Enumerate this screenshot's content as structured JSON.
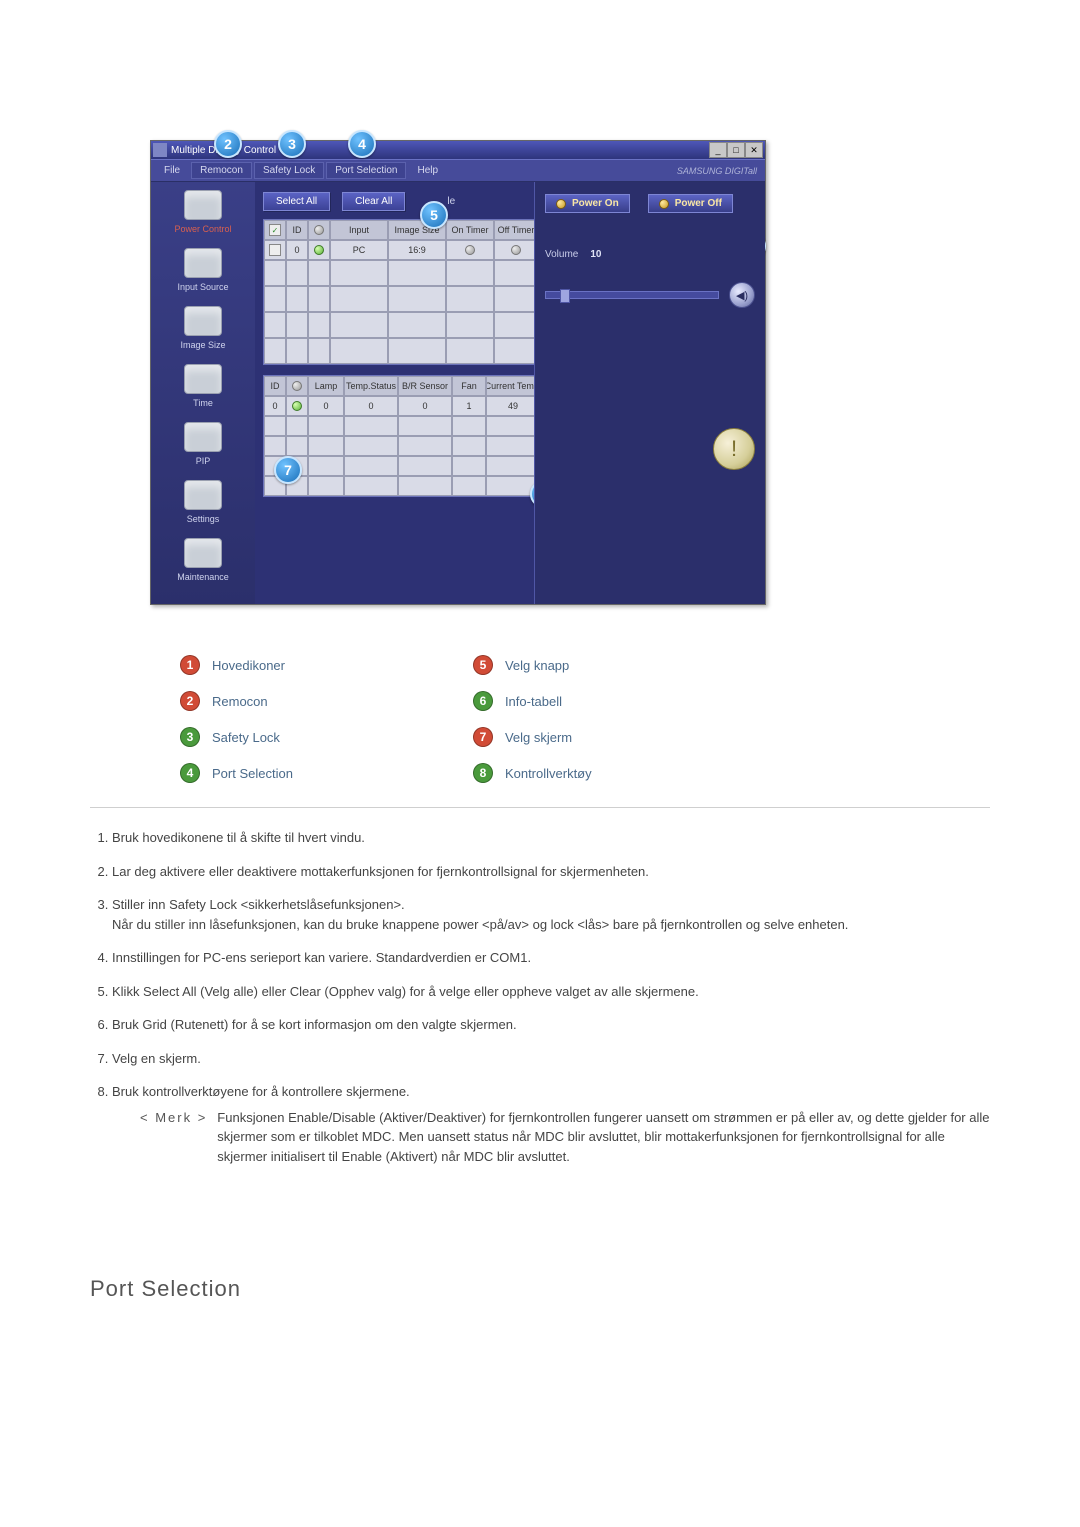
{
  "app": {
    "title": "Multiple Display Control",
    "menu": {
      "file": "File",
      "remocon": "Remocon",
      "safety_lock": "Safety Lock",
      "port_selection": "Port Selection",
      "help": "Help"
    },
    "brand": "SAMSUNG DIGITall",
    "sidebar": {
      "power_control": "Power Control",
      "input_source": "Input Source",
      "image_size": "Image Size",
      "time": "Time",
      "pip": "PIP",
      "settings": "Settings",
      "maintenance": "Maintenance"
    },
    "buttons": {
      "select_all": "Select All",
      "clear_all": "Clear All",
      "select_all_suffix": "le"
    },
    "grid1": {
      "headers": {
        "sel": "✓",
        "id": "ID",
        "status": "●",
        "input": "Input",
        "image_size": "Image Size",
        "on_timer": "On Timer",
        "off_timer": "Off Timer"
      },
      "row": {
        "id": "0",
        "input": "PC",
        "image_size": "16:9"
      }
    },
    "grid2": {
      "headers": {
        "id": "ID",
        "status": "●",
        "lamp": "Lamp",
        "temp_status": "Temp.Status",
        "br_sensor": "B/R Sensor",
        "fan": "Fan",
        "current_temp": "Current Temp."
      },
      "row": {
        "id": "0",
        "lamp": "0",
        "temp_status": "0",
        "br_sensor": "0",
        "fan": "1",
        "current_temp": "49"
      }
    },
    "right": {
      "power_on": "Power On",
      "power_off": "Power Off",
      "volume_label": "Volume",
      "volume_value": "10"
    }
  },
  "legend": {
    "i1": "Hovedikoner",
    "i2": "Remocon",
    "i3": "Safety Lock",
    "i4": "Port Selection",
    "i5": "Velg knapp",
    "i6": "Info-tabell",
    "i7": "Velg skjerm",
    "i8": "Kontrollverktøy"
  },
  "list": {
    "n1": "Bruk hovedikonene til å skifte til hvert vindu.",
    "n2": "Lar deg aktivere eller deaktivere mottakerfunksjonen for fjernkontrollsignal for skjermenheten.",
    "n3a": "Stiller inn Safety Lock <sikkerhetslåsefunksjonen>.",
    "n3b": "Når du stiller inn låsefunksjonen, kan du bruke knappene power <på/av> og lock <lås> bare på fjernkontrollen og selve enheten.",
    "n4": "Innstillingen for PC-ens serieport kan variere. Standardverdien er COM1.",
    "n5": "Klikk Select All (Velg alle) eller Clear (Opphev valg) for å velge eller oppheve valget av alle skjermene.",
    "n6": "Bruk Grid (Rutenett) for å se kort informasjon om den valgte skjermen.",
    "n7": "Velg en skjerm.",
    "n8": "Bruk kontrollverktøyene for å kontrollere skjermene.",
    "note_label": "< Merk >",
    "note_text": "Funksjonen Enable/Disable (Aktiver/Deaktiver) for fjernkontrollen fungerer uansett om strømmen er på eller av, og dette gjelder for alle skjermer som er tilkoblet MDC. Men uansett status når MDC blir avsluttet, blir mottakerfunksjonen for fjernkontrollsignal for alle skjermer initialisert til Enable (Aktivert) når MDC blir avsluttet."
  },
  "section_heading": "Port Selection"
}
